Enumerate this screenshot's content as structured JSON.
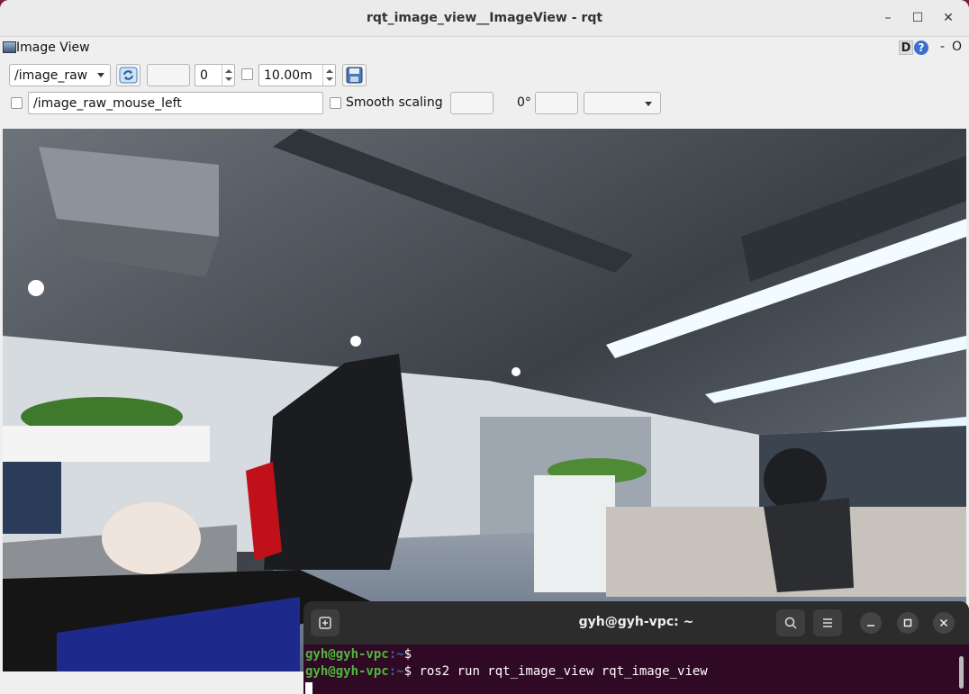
{
  "window": {
    "title": "rqt_image_view__ImageView - rqt",
    "controls": {
      "minimize": "–",
      "maximize": "☐",
      "close": "✕"
    }
  },
  "plugin": {
    "title": "Image View",
    "dock_buttons": {
      "d": "D",
      "help": "?",
      "dash": "-",
      "o": "O"
    }
  },
  "toolbar": {
    "topic": "/image_raw",
    "refresh_icon": "refresh-icon",
    "spin_value": "0",
    "duration": "10.00m",
    "save_icon": "save-icon",
    "mouse_topic": "/image_raw_mouse_left",
    "smooth_scaling_label": "Smooth scaling",
    "rotation_label": "0°"
  },
  "terminal": {
    "title": "gyh@gyh-vpc: ~",
    "lines": [
      {
        "user": "gyh@gyh-vpc",
        "path": ":~",
        "sign": "$ ",
        "cmd": ""
      },
      {
        "user": "gyh@gyh-vpc",
        "path": ":~",
        "sign": "$ ",
        "cmd": "ros2 run rqt_image_view rqt_image_view"
      }
    ]
  }
}
